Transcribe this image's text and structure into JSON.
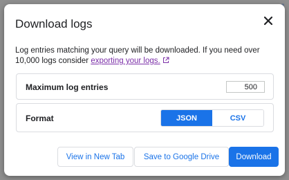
{
  "dialog": {
    "title": "Download logs",
    "description_text": "Log entries matching your query will be downloaded. If you need over 10,000 logs consider ",
    "description_link": "exporting your logs.",
    "max_entries": {
      "label": "Maximum log entries",
      "value": "500"
    },
    "format": {
      "label": "Format",
      "options": [
        "JSON",
        "CSV"
      ],
      "selected": "JSON"
    },
    "buttons": {
      "view_new_tab": "View in New Tab",
      "save_drive": "Save to Google Drive",
      "download": "Download"
    }
  },
  "colors": {
    "accent": "#1a73e8",
    "link": "#7b2fa8",
    "border": "#dadce0"
  },
  "icons": {
    "close": "close-icon",
    "external": "external-link-icon"
  }
}
